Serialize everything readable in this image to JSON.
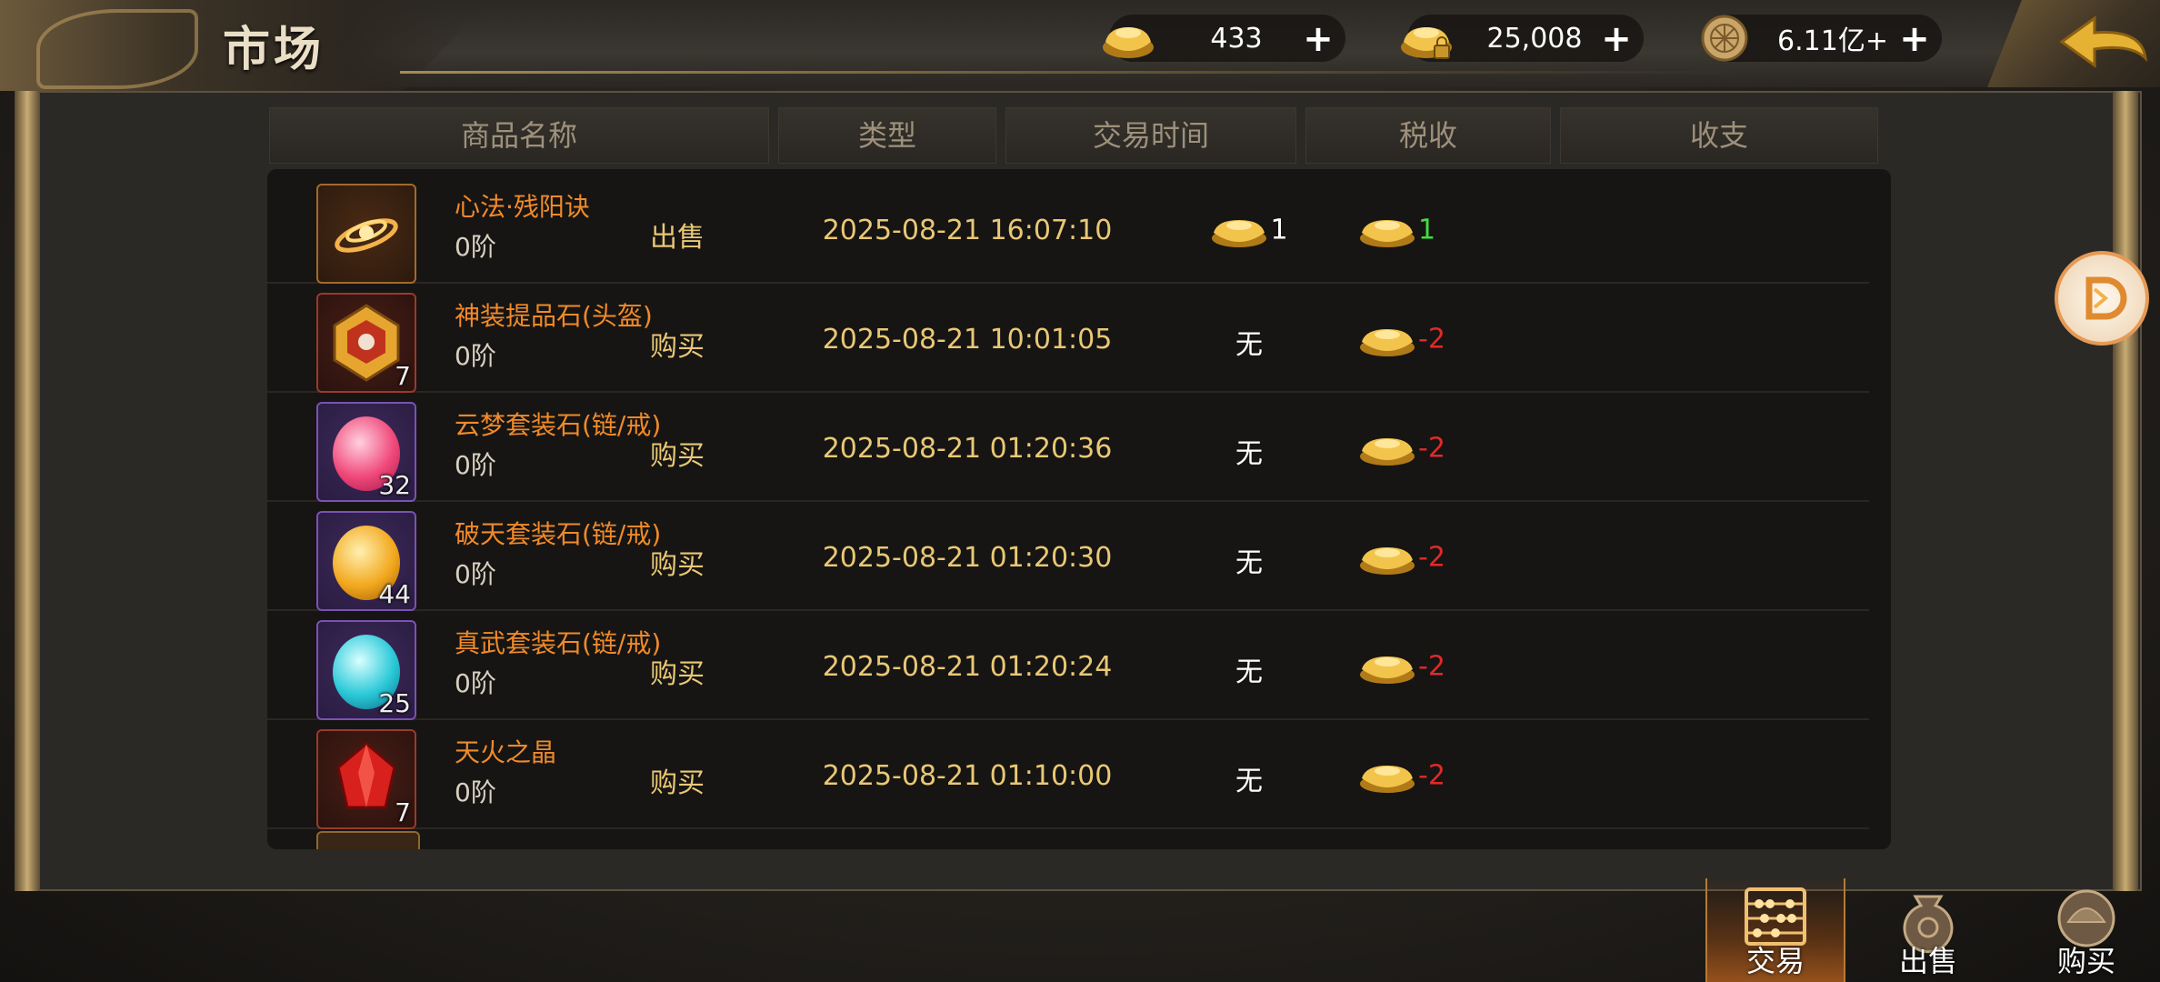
{
  "header": {
    "title": "市场",
    "currencies": [
      {
        "icon": "gold-ingot-icon",
        "value": "433",
        "add_label": "+"
      },
      {
        "icon": "locked-gold-ingot-icon",
        "value": "25,008",
        "add_label": "+"
      },
      {
        "icon": "silver-coin-icon",
        "value": "6.11亿+",
        "add_label": "+"
      }
    ],
    "back_icon": "back-arrow-icon"
  },
  "table": {
    "columns": [
      "商品名称",
      "类型",
      "交易时间",
      "税收",
      "收支"
    ],
    "rows": [
      {
        "icon": "scroll-skill-icon",
        "name": "心法·残阳诀",
        "grade": "0阶",
        "count": "",
        "type": "出售",
        "time": "2025-08-21 16:07:10",
        "tax": "1",
        "tax_has_ingot": true,
        "balance": "1",
        "balance_sign": "pos"
      },
      {
        "icon": "helmet-upgrade-stone-icon",
        "name": "神装提品石(头盔)",
        "grade": "0阶",
        "count": "7",
        "type": "购买",
        "time": "2025-08-21 10:01:05",
        "tax": "无",
        "tax_has_ingot": false,
        "balance": "-2",
        "balance_sign": "neg"
      },
      {
        "icon": "pink-gem-icon",
        "name": "云梦套装石(链/戒)",
        "grade": "0阶",
        "count": "32",
        "type": "购买",
        "time": "2025-08-21 01:20:36",
        "tax": "无",
        "tax_has_ingot": false,
        "balance": "-2",
        "balance_sign": "neg"
      },
      {
        "icon": "amber-gem-icon",
        "name": "破天套装石(链/戒)",
        "grade": "0阶",
        "count": "44",
        "type": "购买",
        "time": "2025-08-21 01:20:30",
        "tax": "无",
        "tax_has_ingot": false,
        "balance": "-2",
        "balance_sign": "neg"
      },
      {
        "icon": "cyan-gem-icon",
        "name": "真武套装石(链/戒)",
        "grade": "0阶",
        "count": "25",
        "type": "购买",
        "time": "2025-08-21 01:20:24",
        "tax": "无",
        "tax_has_ingot": false,
        "balance": "-2",
        "balance_sign": "neg"
      },
      {
        "icon": "red-crystal-icon",
        "name": "天火之晶",
        "grade": "0阶",
        "count": "7",
        "type": "购买",
        "time": "2025-08-21 01:10:00",
        "tax": "无",
        "tax_has_ingot": false,
        "balance": "-2",
        "balance_sign": "neg"
      }
    ]
  },
  "bottom_tabs": [
    {
      "icon": "abacus-icon",
      "label": "交易",
      "active": true
    },
    {
      "icon": "money-bag-icon",
      "label": "出售",
      "active": false
    },
    {
      "icon": "helmet-coin-icon",
      "label": "购买",
      "active": false
    }
  ],
  "colors": {
    "accent_gold": "#e9c875",
    "item_name": "#f08a2a",
    "positive": "#3ee03e",
    "negative": "#e02a2a"
  }
}
